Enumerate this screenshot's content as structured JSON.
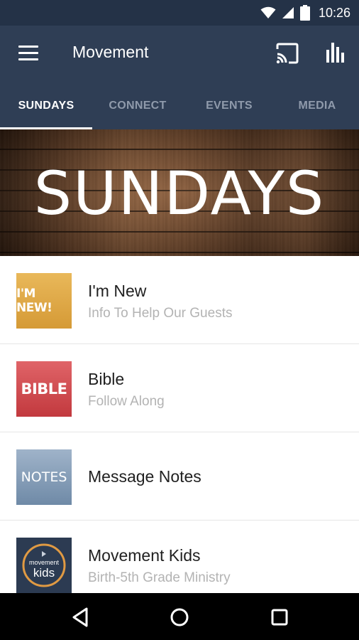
{
  "status_bar": {
    "time": "10:26"
  },
  "app_bar": {
    "title": "Movement"
  },
  "tabs": [
    {
      "label": "SUNDAYS",
      "active": true
    },
    {
      "label": "CONNECT",
      "active": false
    },
    {
      "label": "EVENTS",
      "active": false
    },
    {
      "label": "MEDIA",
      "active": false
    }
  ],
  "hero": {
    "title": "SUNDAYS"
  },
  "items": [
    {
      "title": "I'm New",
      "subtitle": "Info To Help Our Guests",
      "thumb_text": "I'M NEW!",
      "thumb_color": "#dfa646"
    },
    {
      "title": "Bible",
      "subtitle": "Follow Along",
      "thumb_text": "BIBLE",
      "thumb_color": "#d04f53"
    },
    {
      "title": "Message Notes",
      "subtitle": "",
      "thumb_text": "NOTES",
      "thumb_color": "#8aa0b9"
    },
    {
      "title": "Movement Kids",
      "subtitle": "Birth-5th Grade Ministry",
      "thumb_text_top": "movement",
      "thumb_text_bottom": "kids",
      "thumb_color": "#2c3b52"
    }
  ],
  "colors": {
    "app_bar": "#2f3e55",
    "status_bar": "#243247",
    "accent_kids": "#e09a43"
  },
  "icons": [
    "wifi-icon",
    "signal-icon",
    "battery-icon",
    "menu-icon",
    "cast-icon",
    "stats-icon",
    "back-icon",
    "home-icon",
    "recents-icon"
  ]
}
